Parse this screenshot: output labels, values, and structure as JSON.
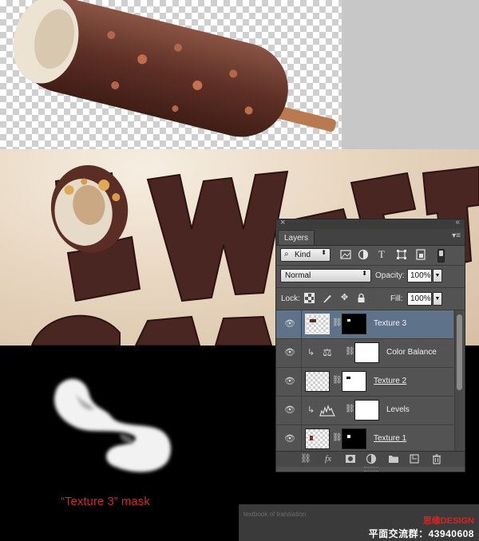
{
  "caption": "“Texture 3” mask",
  "watermark": {
    "subtitle": "textbook of translation",
    "brand": "思缘DESIGN",
    "group": "平面交流群：43940608"
  },
  "panel": {
    "close_glyph": "×",
    "collapse_glyph": "«",
    "tab_label": "Layers",
    "menu_glyph": "≡",
    "filter": {
      "kind_label": "Kind",
      "icons": [
        "image-filter-icon",
        "adjustment-filter-icon",
        "type-filter-icon",
        "shape-filter-icon",
        "smart-object-filter-icon"
      ]
    },
    "blend_mode": "Normal",
    "opacity_label": "Opacity:",
    "opacity_value": "100%",
    "lock_label": "Lock:",
    "fill_label": "Fill:",
    "fill_value": "100%",
    "layers": [
      {
        "name": "Texture 3",
        "selected": true,
        "clipped": false,
        "type": "image"
      },
      {
        "name": "Color Balance",
        "selected": false,
        "clipped": true,
        "type": "adjustment"
      },
      {
        "name": "Texture 2",
        "selected": false,
        "clipped": false,
        "type": "image"
      },
      {
        "name": "Levels",
        "selected": false,
        "clipped": true,
        "type": "adjustment"
      },
      {
        "name": "Texture 1",
        "selected": false,
        "clipped": false,
        "type": "image"
      }
    ]
  },
  "colors": {
    "caption": "#d0262e",
    "selected_layer": "#5e738a",
    "panel_bg": "#535353"
  }
}
